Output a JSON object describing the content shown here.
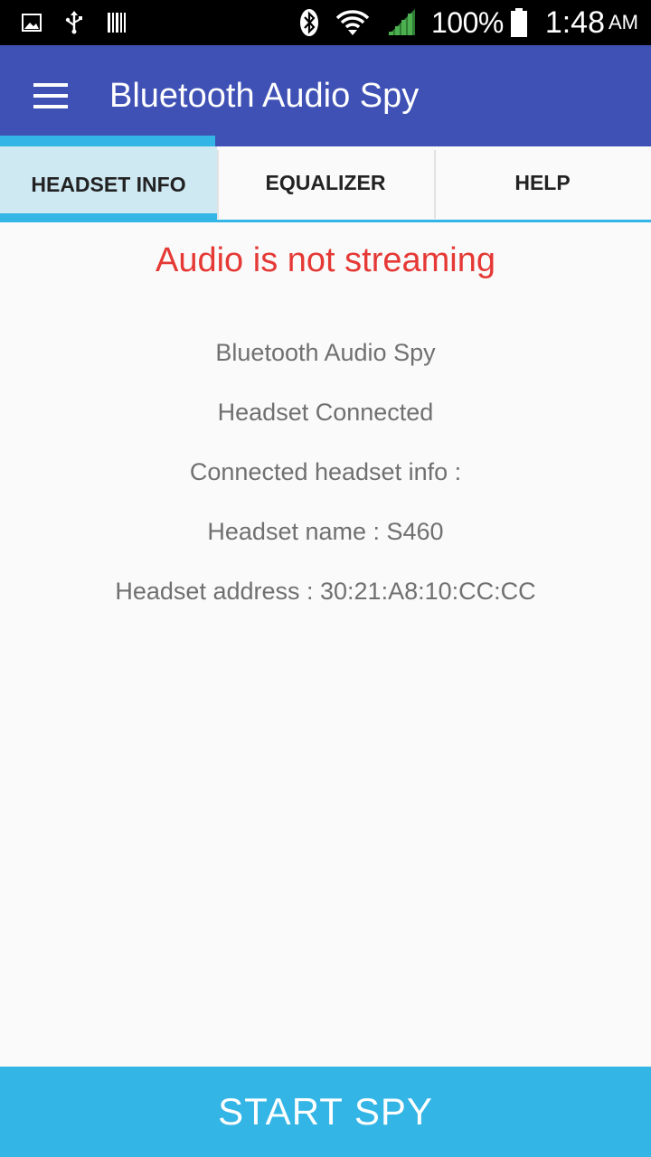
{
  "status_bar": {
    "icons_left": [
      "image-icon",
      "usb-icon",
      "barcode-icon"
    ],
    "icons_right": [
      "bluetooth-icon",
      "wifi-icon",
      "signal-icon"
    ],
    "battery": "100%",
    "time": "1:48",
    "ampm": "AM"
  },
  "app_bar": {
    "title": "Bluetooth Audio Spy",
    "menu_icon": "hamburger-menu-icon",
    "color": "#3f51b5"
  },
  "tabs": [
    {
      "label": "HEADSET INFO",
      "active": true
    },
    {
      "label": "EQUALIZER",
      "active": false
    },
    {
      "label": "HELP",
      "active": false
    }
  ],
  "content": {
    "stream_status": "Audio is not streaming",
    "app_name": "Bluetooth Audio Spy",
    "connection_status": "Headset Connected",
    "info_heading": "Connected headset info :",
    "headset_name": "Headset name : S460",
    "headset_address": "Headset address : 30:21:A8:10:CC:CC"
  },
  "start_button": {
    "label": "START SPY"
  },
  "colors": {
    "accent": "#33b5e5",
    "error": "#e53935",
    "active_tab_bg": "#cfe9f3"
  }
}
